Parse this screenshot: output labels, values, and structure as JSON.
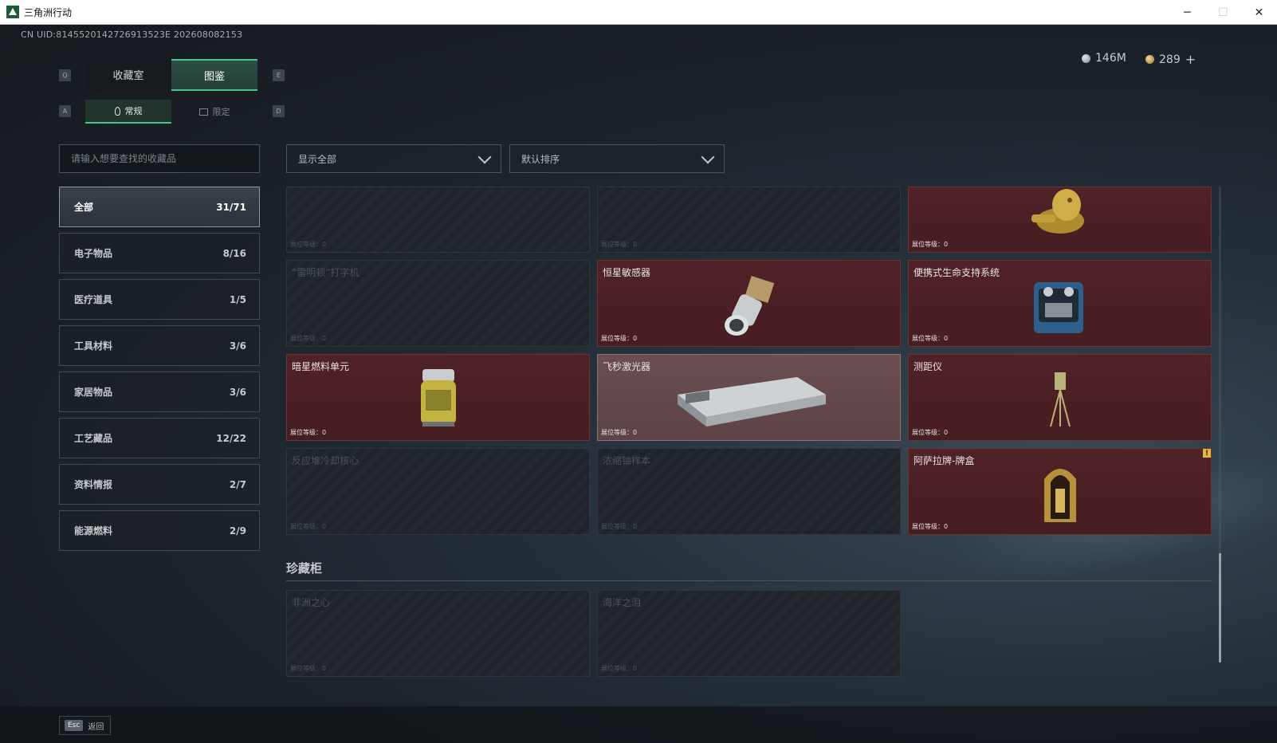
{
  "window": {
    "title": "三角洲行动"
  },
  "header": {
    "uid": "CN UID:8145520142726913523E 202608082153",
    "currency": {
      "silver": "146M",
      "gold": "289",
      "plus": "+"
    }
  },
  "keyhints": {
    "q": "Q",
    "e": "E",
    "a": "A",
    "d": "D"
  },
  "tabs_main": [
    {
      "label": "收藏室",
      "active": false
    },
    {
      "label": "图鉴",
      "active": true
    }
  ],
  "tabs_sub": [
    {
      "label": "常规",
      "icon": "flame-icon",
      "active": true
    },
    {
      "label": "限定",
      "icon": "frame-icon",
      "active": false
    }
  ],
  "search": {
    "placeholder": "请输入想要查找的收藏品"
  },
  "filters": {
    "display": "显示全部",
    "sort": "默认排序"
  },
  "sidebar": [
    {
      "label": "全部",
      "count": "31/71",
      "active": true
    },
    {
      "label": "电子物品",
      "count": "8/16"
    },
    {
      "label": "医疗道具",
      "count": "1/5"
    },
    {
      "label": "工具材料",
      "count": "3/6"
    },
    {
      "label": "家居物品",
      "count": "3/6"
    },
    {
      "label": "工艺藏品",
      "count": "12/22"
    },
    {
      "label": "资料情报",
      "count": "2/7"
    },
    {
      "label": "能源燃料",
      "count": "2/9"
    }
  ],
  "cards": [
    {
      "name": "",
      "level": "展位等级：0",
      "state": "locked"
    },
    {
      "name": "",
      "level": "展位等级：0",
      "state": "locked"
    },
    {
      "name": "",
      "level": "展位等级：0",
      "state": "owned"
    },
    {
      "name": "“雷明顿”打字机",
      "level": "展位等级：0",
      "state": "locked"
    },
    {
      "name": "恒星敏感器",
      "level": "展位等级：0",
      "state": "owned"
    },
    {
      "name": "便携式生命支持系统",
      "level": "展位等级：0",
      "state": "owned"
    },
    {
      "name": "暗星燃料单元",
      "level": "展位等级：0",
      "state": "owned"
    },
    {
      "name": "飞秒激光器",
      "level": "展位等级：0",
      "state": "highlighted"
    },
    {
      "name": "测距仪",
      "level": "展位等级：0",
      "state": "owned"
    },
    {
      "name": "反应堆冷却核心",
      "level": "展位等级：0",
      "state": "locked"
    },
    {
      "name": "浓缩铀样本",
      "level": "展位等级：0",
      "state": "locked"
    },
    {
      "name": "阿萨拉牌-牌盒",
      "level": "展位等级：0",
      "state": "owned",
      "badge": "!"
    }
  ],
  "treasure_section": {
    "title": "珍藏柜",
    "cards": [
      {
        "name": "非洲之心",
        "level": "展位等级：0",
        "state": "locked"
      },
      {
        "name": "海洋之泪",
        "level": "展位等级：0",
        "state": "locked"
      }
    ]
  },
  "footer": {
    "esc_key": "Esc",
    "esc_label": "返回"
  }
}
